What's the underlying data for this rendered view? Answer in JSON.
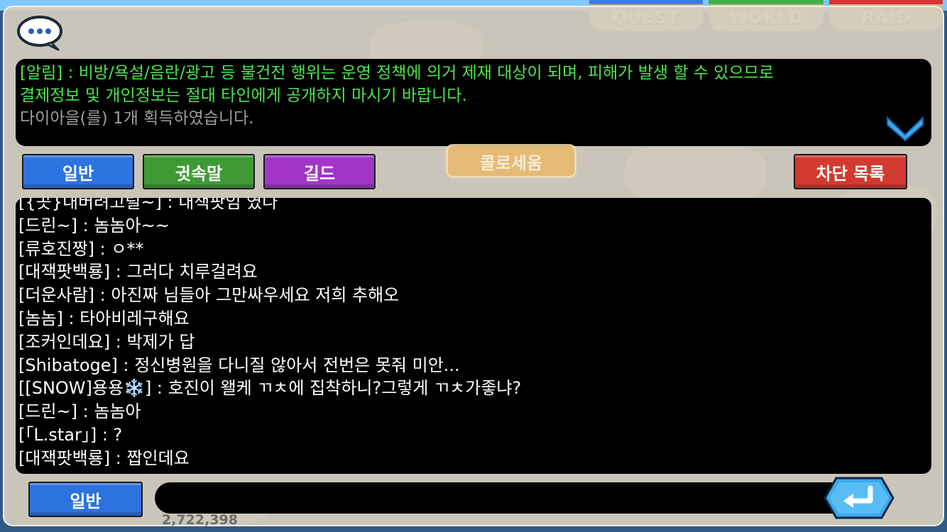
{
  "game_tabs": {
    "quest": "QUEST",
    "world": "WORLD",
    "raid": "RAID"
  },
  "notice": {
    "line1": "[알림] : 비방/욕설/음란/광고 등 불건전 행위는 운영 정책에 의거 제재 대상이 되며, 피해가 발생 할 수 있으므로",
    "line2": "결제정보 및 개인정보는 절대 타인에게 공개하지 마시기 바랍니다.",
    "line3": "다이아을(를) 1개 획득하였습니다."
  },
  "channels": {
    "general": "일반",
    "whisper": "귓속말",
    "guild": "길드",
    "block_list": "차단 목록"
  },
  "background_sign": "콜로세움",
  "chat_lines": [
    "[{곳}내버려고릴~] : 내책팟임 였나",
    "[드린~] : 놈놈아~~",
    "[류호진짱] :  ㅇ**",
    "[대잭팟백룡] : 그러다 치루걸려요",
    "[더운사람] : 아진짜 님들아 그만싸우세요 저희 추해오",
    "[놈놈] : 타아비레구해요",
    "[조커인데요] : 박제가 답",
    "[Shibatoge] : 정신병원을 다니질 않아서 전번은 못줘 미안...",
    "[[SNOW]용용❄️] : 호진이 왤케 ㄲㅊ에 집착하니?그렇게 ㄲㅊ가좋냐?",
    "[드린~] : 놈놈아",
    "[「L.star」] : ?",
    "[대잭팟백룡] : 짭인데요"
  ],
  "input": {
    "channel_label": "일반",
    "value": ""
  },
  "under_text": "2,722,398",
  "icons": {
    "chat": "chat-bubble-icon",
    "scroll": "chevron-down-icon",
    "send": "enter-arrow-icon"
  },
  "colors": {
    "notice_green": "#4ee44e",
    "general_blue": "#2c73e0",
    "whisper_green": "#3f9a36",
    "guild_purple": "#a235c8",
    "block_red": "#d23a2f"
  }
}
